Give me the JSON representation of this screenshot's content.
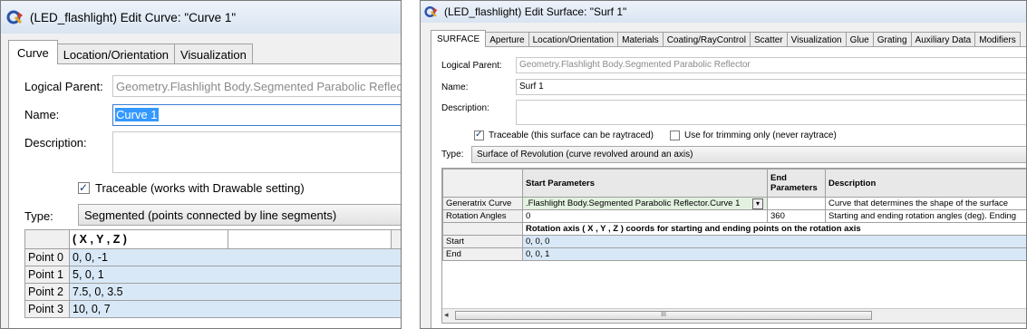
{
  "curve_dialog": {
    "title": "(LED_flashlight) Edit Curve: \"Curve 1\"",
    "tabs": [
      "Curve",
      "Location/Orientation",
      "Visualization"
    ],
    "logical_parent_label": "Logical Parent:",
    "logical_parent_value": "Geometry.Flashlight Body.Segmented Parabolic Reflector",
    "name_label": "Name:",
    "name_value": "Curve 1",
    "description_label": "Description:",
    "description_value": "",
    "traceable_label": "Traceable  (works with Drawable setting)",
    "traceable_checked": true,
    "type_label": "Type:",
    "type_value": "Segmented  (points connected by line segments)",
    "points_header": "( X , Y , Z )",
    "points": [
      {
        "label": "Point 0",
        "value": "0,  0,  -1"
      },
      {
        "label": "Point 1",
        "value": "5,  0,  1"
      },
      {
        "label": "Point 2",
        "value": "7.5,  0,  3.5"
      },
      {
        "label": "Point 3",
        "value": "10,  0,  7"
      }
    ]
  },
  "surface_dialog": {
    "title": "(LED_flashlight) Edit Surface: \"Surf 1\"",
    "tabs": [
      "SURFACE",
      "Aperture",
      "Location/Orientation",
      "Materials",
      "Coating/RayControl",
      "Scatter",
      "Visualization",
      "Glue",
      "Grating",
      "Auxiliary Data",
      "Modifiers"
    ],
    "logical_parent_label": "Logical Parent:",
    "logical_parent_value": "Geometry.Flashlight Body.Segmented Parabolic Reflector",
    "name_label": "Name:",
    "name_value": "Surf 1",
    "description_label": "Description:",
    "description_value": "",
    "traceable_label": "Traceable (this surface can be raytraced)",
    "traceable_checked": true,
    "trim_label": "Use for trimming only (never raytrace)",
    "trim_checked": false,
    "type_label": "Type:",
    "type_value": "Surface of Revolution  (curve revolved around an axis)",
    "table_headers": {
      "start": "Start Parameters",
      "end": "End Parameters",
      "description": "Description"
    },
    "rows": [
      {
        "label": "Generatrix Curve",
        "start": ".Flashlight Body.Segmented Parabolic Reflector.Curve 1",
        "end": "",
        "description": "Curve that determines the shape of the surface"
      },
      {
        "label": "Rotation Angles",
        "start": "0",
        "end": "360",
        "description": "Starting and ending rotation angles (deg).  Ending"
      }
    ],
    "axis_header": "Rotation axis ( X , Y , Z ) coords for starting and ending points on the rotation axis",
    "axis_rows": [
      {
        "label": "Start",
        "value": "0,  0,  0"
      },
      {
        "label": "End",
        "value": "0,  0,  1"
      }
    ],
    "scrollbar_thumb_glyph": "III"
  }
}
